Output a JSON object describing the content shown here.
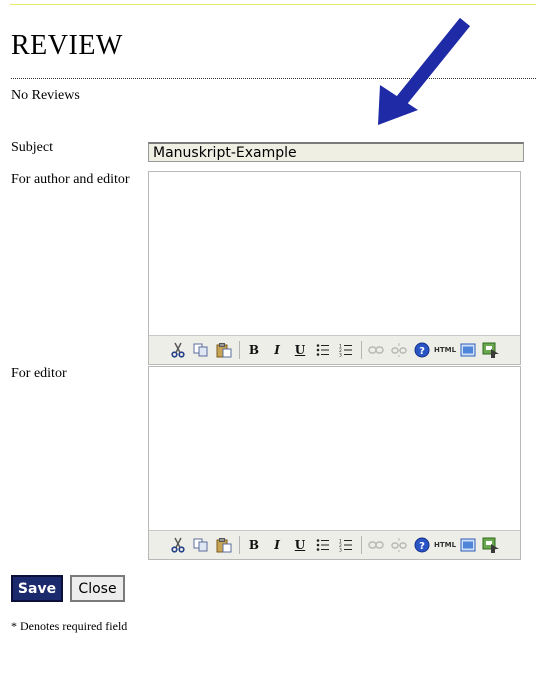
{
  "page": {
    "title": "REVIEW",
    "status": "No Reviews"
  },
  "form": {
    "subject_label": "Subject",
    "subject_value": "Manuskript-Example",
    "author_editor_label": "For author and editor",
    "editor_label": "For editor",
    "save_label": "Save",
    "close_label": "Close",
    "required_note": "* Denotes required field"
  },
  "toolbar": {
    "bold": "B",
    "italic": "I",
    "underline": "U",
    "html": "HTML"
  },
  "colors": {
    "arrow": "#1e2aa6",
    "save_button": "#1a2a6c",
    "toolbar_bg": "#eeeee8"
  },
  "icons": [
    "cut-icon",
    "copy-icon",
    "paste-icon",
    "bold-icon",
    "italic-icon",
    "underline-icon",
    "bullet-list-icon",
    "numbered-list-icon",
    "link-icon",
    "unlink-icon",
    "help-icon",
    "html-icon",
    "fullscreen-icon",
    "image-icon"
  ]
}
